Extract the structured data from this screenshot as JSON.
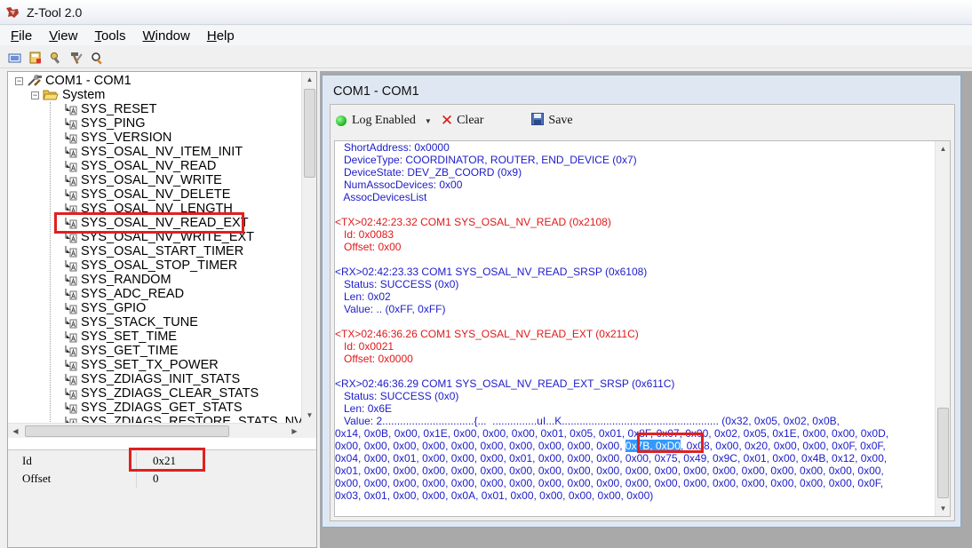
{
  "window": {
    "title": "Z-Tool 2.0"
  },
  "menu": [
    {
      "key": "F",
      "rest": "ile"
    },
    {
      "key": "V",
      "rest": "iew"
    },
    {
      "key": "T",
      "rest": "ools"
    },
    {
      "key": "W",
      "rest": "indow"
    },
    {
      "key": "H",
      "rest": "elp"
    }
  ],
  "toolbar_icons": [
    "open-icon",
    "save-config-icon",
    "tools-icon",
    "hammer-icon",
    "search-device-icon"
  ],
  "tree": {
    "root": "COM1 - COM1",
    "group": "System",
    "items": [
      "SYS_RESET",
      "SYS_PING",
      "SYS_VERSION",
      "SYS_OSAL_NV_ITEM_INIT",
      "SYS_OSAL_NV_READ",
      "SYS_OSAL_NV_WRITE",
      "SYS_OSAL_NV_DELETE",
      "SYS_OSAL_NV_LENGTH",
      "SYS_OSAL_NV_READ_EXT",
      "SYS_OSAL_NV_WRITE_EXT",
      "SYS_OSAL_START_TIMER",
      "SYS_OSAL_STOP_TIMER",
      "SYS_RANDOM",
      "SYS_ADC_READ",
      "SYS_GPIO",
      "SYS_STACK_TUNE",
      "SYS_SET_TIME",
      "SYS_GET_TIME",
      "SYS_SET_TX_POWER",
      "SYS_ZDIAGS_INIT_STATS",
      "SYS_ZDIAGS_CLEAR_STATS",
      "SYS_ZDIAGS_GET_STATS",
      "SYS_ZDIAGS_RESTORE_STATS_NV"
    ]
  },
  "properties": [
    {
      "name": "Id",
      "value": "0x21"
    },
    {
      "name": "Offset",
      "value": "0"
    }
  ],
  "log_window": {
    "title": "COM1 - COM1",
    "log_enabled_label": "Log Enabled",
    "clear_label": "Clear",
    "save_label": "Save"
  },
  "log_lines": [
    {
      "t": "   ShortAddress: 0x0000",
      "c": "blue"
    },
    {
      "t": "   DeviceType: COORDINATOR, ROUTER, END_DEVICE (0x7)",
      "c": "blue"
    },
    {
      "t": "   DeviceState: DEV_ZB_COORD (0x9)",
      "c": "blue"
    },
    {
      "t": "   NumAssocDevices: 0x00",
      "c": "blue"
    },
    {
      "t": "   AssocDevicesList",
      "c": "blue"
    },
    {
      "t": "",
      "c": "blue"
    },
    {
      "t": "<TX>02:42:23.32 COM1 SYS_OSAL_NV_READ (0x2108)",
      "c": "red"
    },
    {
      "t": "   Id: 0x0083",
      "c": "red"
    },
    {
      "t": "   Offset: 0x00",
      "c": "red"
    },
    {
      "t": "",
      "c": "blue"
    },
    {
      "t": "<RX>02:42:23.33 COM1 SYS_OSAL_NV_READ_SRSP (0x6108)",
      "c": "blue"
    },
    {
      "t": "   Status: SUCCESS (0x0)",
      "c": "blue"
    },
    {
      "t": "   Len: 0x02",
      "c": "blue"
    },
    {
      "t": "   Value: .. (0xFF, 0xFF)",
      "c": "blue"
    },
    {
      "t": "",
      "c": "blue"
    },
    {
      "t": "<TX>02:46:36.26 COM1 SYS_OSAL_NV_READ_EXT (0x211C)",
      "c": "red"
    },
    {
      "t": "   Id: 0x0021",
      "c": "red"
    },
    {
      "t": "   Offset: 0x0000",
      "c": "red"
    },
    {
      "t": "",
      "c": "blue"
    },
    {
      "t": "<RX>02:46:36.29 COM1 SYS_OSAL_NV_READ_EXT_SRSP (0x611C)",
      "c": "blue"
    },
    {
      "t": "   Status: SUCCESS (0x0)",
      "c": "blue"
    },
    {
      "t": "   Len: 0x6E",
      "c": "blue"
    },
    {
      "t": "   Value: 2...............................{...  ...............uI...K..................................................... (0x32, 0x05, 0x02, 0x0B,",
      "c": "blue"
    },
    {
      "t": "0x14, 0x0B, 0x00, 0x1E, 0x00, 0x00, 0x00, 0x01, 0x05, 0x01, 0x8F, 0x07, 0x00, 0x02, 0x05, 0x1E, 0x00, 0x00, 0x0D,",
      "c": "blue"
    },
    {
      "pre": "0x00, 0x00, 0x00, 0x00, 0x00, 0x00, 0x00, 0x00, 0x00, 0x00, ",
      "hl": "0x7B, 0xD0",
      "post": ", 0x08, 0x00, 0x20, 0x00, 0x00, 0x0F, 0x0F,",
      "c": "blue"
    },
    {
      "t": "0x04, 0x00, 0x01, 0x00, 0x00, 0x00, 0x01, 0x00, 0x00, 0x00, 0x00, 0x75, 0x49, 0x9C, 0x01, 0x00, 0x4B, 0x12, 0x00,",
      "c": "blue"
    },
    {
      "t": "0x01, 0x00, 0x00, 0x00, 0x00, 0x00, 0x00, 0x00, 0x00, 0x00, 0x00, 0x00, 0x00, 0x00, 0x00, 0x00, 0x00, 0x00, 0x00,",
      "c": "blue"
    },
    {
      "t": "0x00, 0x00, 0x00, 0x00, 0x00, 0x00, 0x00, 0x00, 0x00, 0x00, 0x00, 0x00, 0x00, 0x00, 0x00, 0x00, 0x00, 0x00, 0x0F,",
      "c": "blue"
    },
    {
      "t": "0x03, 0x01, 0x00, 0x00, 0x0A, 0x01, 0x00, 0x00, 0x00, 0x00, 0x00)",
      "c": "blue"
    }
  ],
  "colors": {
    "tx": "#e01818",
    "rx": "#1c1cc8",
    "highlight": "#3399ff",
    "annotation": "#e02020"
  }
}
